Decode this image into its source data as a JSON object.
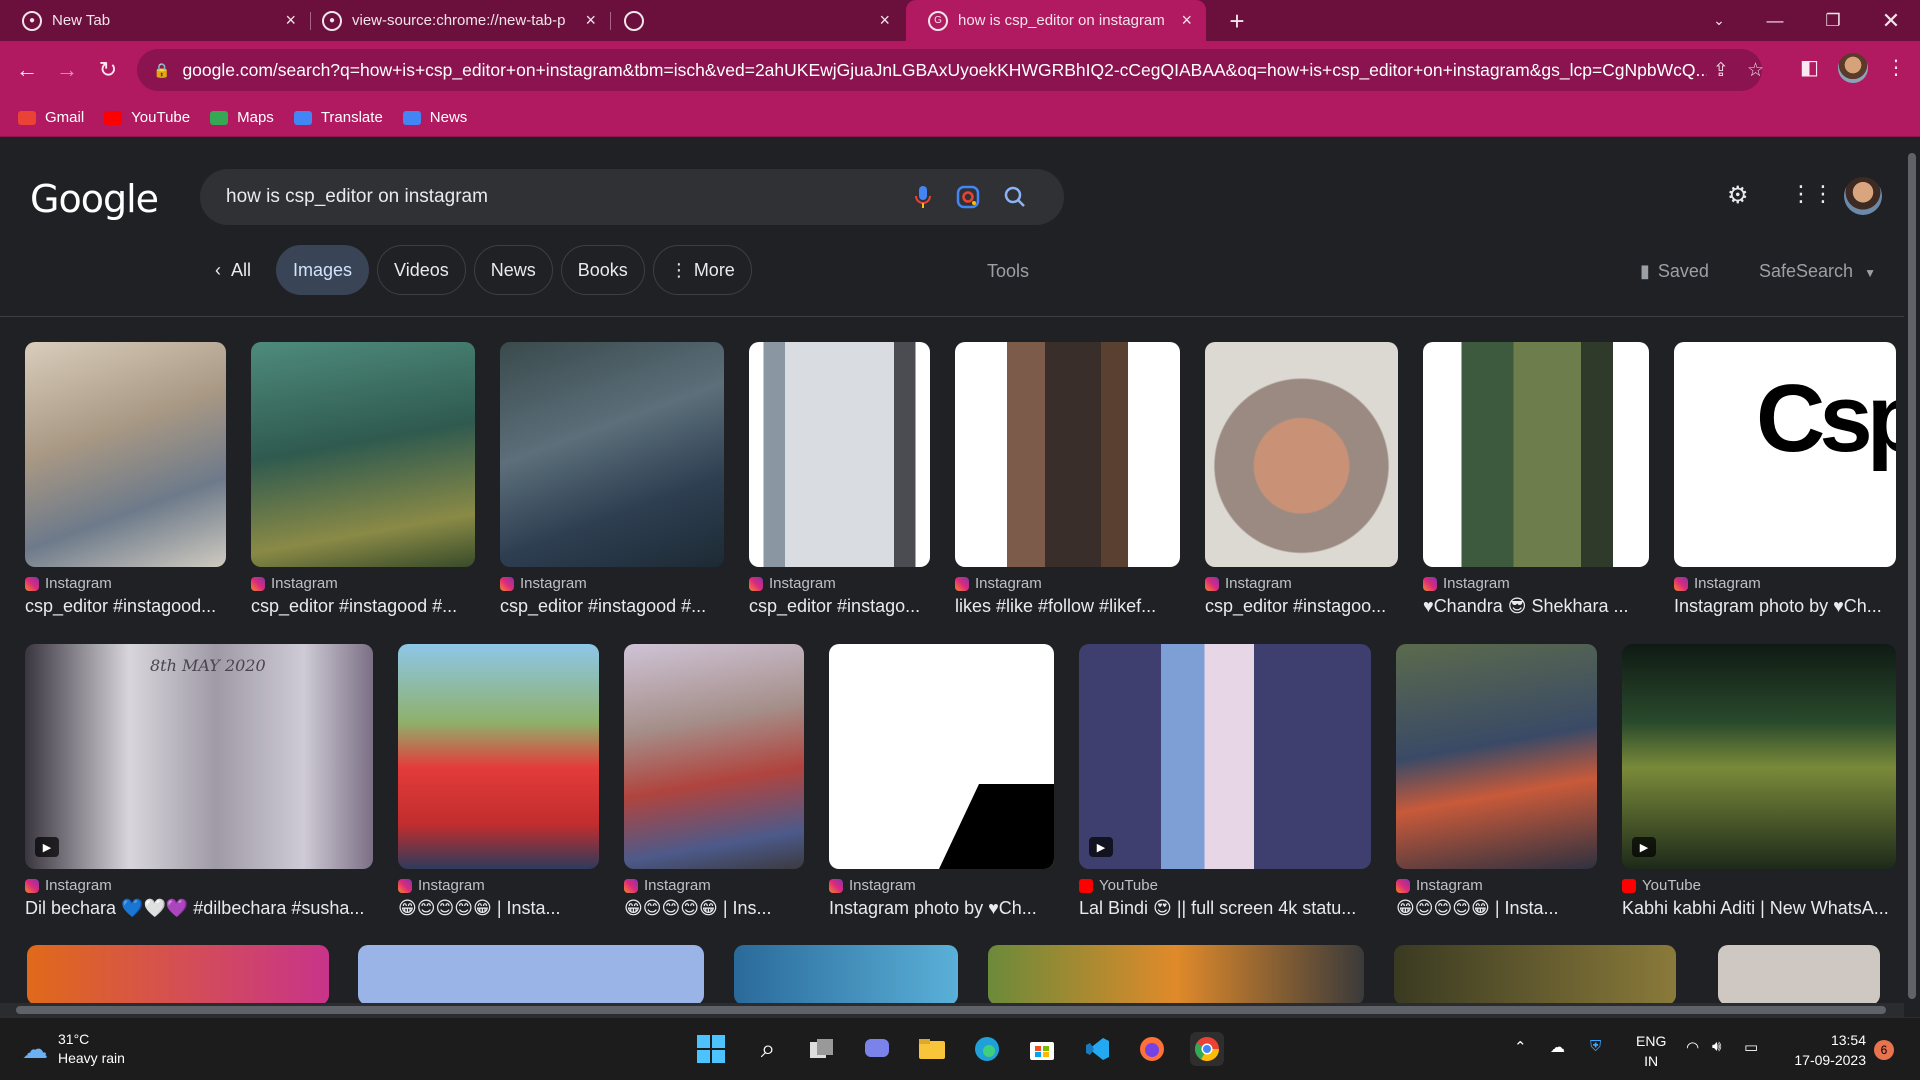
{
  "browser": {
    "tabs": [
      {
        "title": "New Tab",
        "active": false
      },
      {
        "title": "view-source:chrome://new-tab-p",
        "active": false
      },
      {
        "title": "",
        "active": false
      },
      {
        "title": "how is csp_editor on instagram",
        "active": true
      }
    ],
    "url": "google.com/search?q=how+is+csp_editor+on+instagram&tbm=isch&ved=2ahUKEwjGjuaJnLGBAxUyoekKHWGRBhIQ2-cCegQIABAA&oq=how+is+csp_editor+on+instagram&gs_lcp=CgNpbWcQ...",
    "bookmarks": [
      {
        "label": "Gmail",
        "icon": "gmail-icon",
        "color": "#ea4335"
      },
      {
        "label": "YouTube",
        "icon": "youtube-icon",
        "color": "#ff0000"
      },
      {
        "label": "Maps",
        "icon": "maps-icon",
        "color": "#34a853"
      },
      {
        "label": "Translate",
        "icon": "translate-icon",
        "color": "#4285f4"
      },
      {
        "label": "News",
        "icon": "news-icon",
        "color": "#4285f4"
      }
    ]
  },
  "google": {
    "logo": "Google",
    "query": "how is csp_editor on instagram",
    "chips": [
      {
        "label": "All",
        "active": false
      },
      {
        "label": "Images",
        "active": true
      },
      {
        "label": "Videos",
        "active": false
      },
      {
        "label": "News",
        "active": false
      },
      {
        "label": "Books",
        "active": false
      },
      {
        "label": "More",
        "active": false
      }
    ],
    "tools": "Tools",
    "saved": "Saved",
    "safesearch": "SafeSearch"
  },
  "results": [
    {
      "source": "Instagram",
      "title": "csp_editor #instagood...",
      "src_type": "ig"
    },
    {
      "source": "Instagram",
      "title": "csp_editor #instagood #...",
      "src_type": "ig"
    },
    {
      "source": "Instagram",
      "title": "csp_editor #instagood #...",
      "src_type": "ig"
    },
    {
      "source": "Instagram",
      "title": "csp_editor #instago...",
      "src_type": "ig"
    },
    {
      "source": "Instagram",
      "title": "likes #like #follow #likef...",
      "src_type": "ig"
    },
    {
      "source": "Instagram",
      "title": "csp_editor #instagoo...",
      "src_type": "ig"
    },
    {
      "source": "Instagram",
      "title": "♥Chandra 😎 Shekhara ...",
      "src_type": "ig"
    },
    {
      "source": "Instagram",
      "title": "Instagram photo by ♥Ch...",
      "src_type": "ig",
      "thumb_text": "Csp"
    },
    {
      "source": "Instagram",
      "title": "Dil bechara 💙🤍💜 #dilbechara #susha...",
      "src_type": "ig",
      "thumb_text": "8th MAY 2020",
      "video": true
    },
    {
      "source": "Instagram",
      "title": "😁😊😊😊😁 | Insta...",
      "src_type": "ig"
    },
    {
      "source": "Instagram",
      "title": "😁😊😊😊😁 | Ins...",
      "src_type": "ig"
    },
    {
      "source": "Instagram",
      "title": "Instagram photo by ♥Ch...",
      "src_type": "ig"
    },
    {
      "source": "YouTube",
      "title": "Lal Bindi 😍 || full screen 4k statu...",
      "src_type": "yt",
      "video": true
    },
    {
      "source": "Instagram",
      "title": "😁😊😊😊😁 | Insta...",
      "src_type": "ig"
    },
    {
      "source": "YouTube",
      "title": "Kabhi kabhi Aditi | New WhatsA...",
      "src_type": "yt",
      "video": true
    }
  ],
  "taskbar": {
    "weather_temp": "31°C",
    "weather_desc": "Heavy rain",
    "lang1": "ENG",
    "lang2": "IN",
    "time": "13:54",
    "date": "17-09-2023",
    "notifications": "6"
  }
}
